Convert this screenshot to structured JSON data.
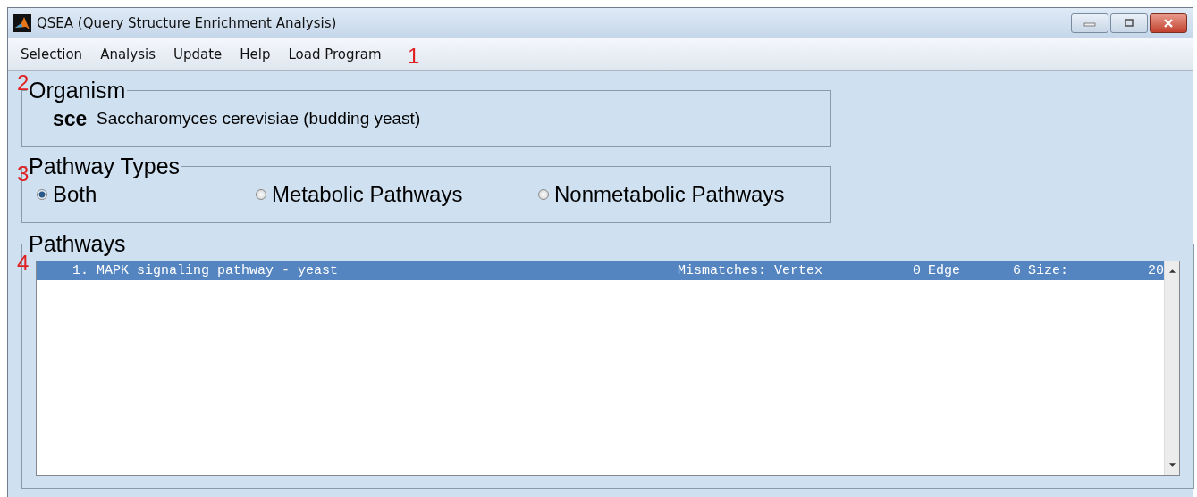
{
  "window": {
    "title": "QSEA (Query Structure Enrichment Analysis)"
  },
  "menu": [
    "Selection",
    "Analysis",
    "Update",
    "Help",
    "Load Program"
  ],
  "callouts": [
    "1",
    "2",
    "3",
    "4"
  ],
  "organism": {
    "legend": "Organism",
    "code": "sce",
    "name": "Saccharomyces cerevisiae (budding yeast)"
  },
  "pathway_types": {
    "legend": "Pathway Types",
    "options": [
      {
        "label": "Both",
        "selected": true
      },
      {
        "label": "Metabolic Pathways",
        "selected": false
      },
      {
        "label": "Nonmetabolic Pathways",
        "selected": false
      }
    ]
  },
  "pathways": {
    "legend": "Pathways",
    "rows": [
      {
        "selected": true,
        "name": "1. MAPK signaling pathway - yeast",
        "mismatches": "Mismatches: Vertex",
        "vertex": "0",
        "edge_label": "Edge",
        "edge": "6",
        "size_label": "Size:",
        "size": "20"
      }
    ]
  }
}
